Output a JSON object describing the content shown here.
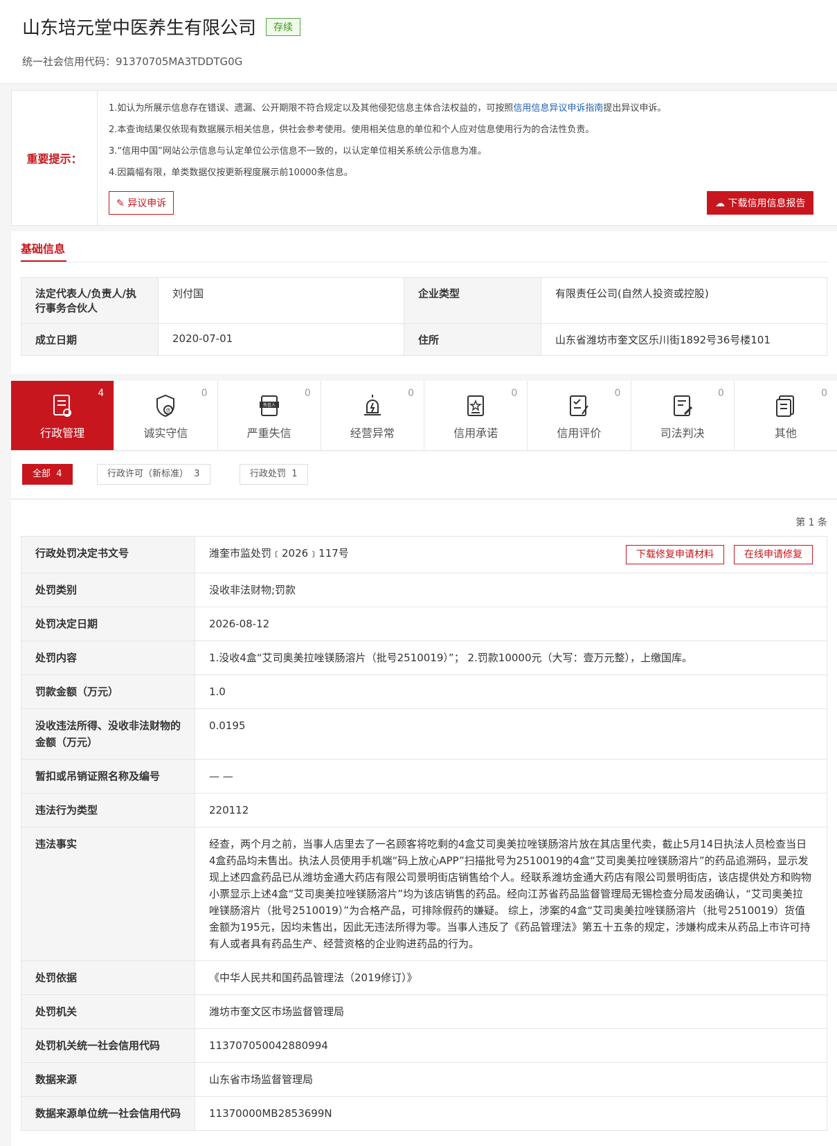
{
  "company": {
    "name": "山东培元堂中医养生有限公司",
    "status": "存续",
    "credit_code_label": "统一社会信用代码：",
    "credit_code": "91370705MA3TDDTG0G"
  },
  "notice": {
    "label": "重要提示：",
    "line1_prefix": "1.如认为所展示信息存在错误、遗漏、公开期限不符合规定以及其他侵犯信息主体合法权益的，可按照",
    "line1_link": "信用信息异议申诉指南",
    "line1_suffix": "提出异议申诉。",
    "line2": "2.本查询结果仅依现有数据展示相关信息，供社会参考使用。使用相关信息的单位和个人应对信息使用行为的合法性负责。",
    "line3": "3.“信用中国”网站公示信息与认定单位公示信息不一致的，以认定单位相关系统公示信息为准。",
    "line4": "4.因篇幅有限，单类数据仅按更新程度展示前10000条信息。",
    "objection_button": "异议申诉",
    "download_button": "下载信用信息报告"
  },
  "basic": {
    "title": "基础信息",
    "legal_rep_label": "法定代表人/负责人/执行事务合伙人",
    "legal_rep_value": "刘付国",
    "type_label": "企业类型",
    "type_value": "有限责任公司(自然人投资或控股)",
    "founded_label": "成立日期",
    "founded_value": "2020-07-01",
    "address_label": "住所",
    "address_value": "山东省潍坊市奎文区乐川街1892号36号楼101"
  },
  "tabs": [
    {
      "label": "行政管理",
      "count": "4",
      "icon": "admin-doc-icon"
    },
    {
      "label": "诚实守信",
      "count": "0",
      "icon": "shield-icon"
    },
    {
      "label": "严重失信",
      "count": "0",
      "icon": "dishonest-icon"
    },
    {
      "label": "经营异常",
      "count": "0",
      "icon": "alarm-icon"
    },
    {
      "label": "信用承诺",
      "count": "0",
      "icon": "promise-icon"
    },
    {
      "label": "信用评价",
      "count": "0",
      "icon": "rating-icon"
    },
    {
      "label": "司法判决",
      "count": "0",
      "icon": "judgement-icon"
    },
    {
      "label": "其他",
      "count": "0",
      "icon": "other-icon"
    }
  ],
  "filters": [
    {
      "label": "全部",
      "count": "4"
    },
    {
      "label": "行政许可（新标准）",
      "count": "3"
    },
    {
      "label": "行政处罚",
      "count": "1"
    }
  ],
  "detail": {
    "page_count": "第 1 条",
    "download_repair_button": "下载修复申请材料",
    "online_repair_button": "在线申请修复",
    "rows": [
      {
        "label": "行政处罚决定书文号",
        "value": "潍奎市监处罚﹝2026﹞117号"
      },
      {
        "label": "处罚类别",
        "value": "没收非法财物;罚款"
      },
      {
        "label": "处罚决定日期",
        "value": "2026-08-12"
      },
      {
        "label": "处罚内容",
        "value": "1.没收4盒“艾司奥美拉唑镁肠溶片（批号2510019）”； 2.罚款10000元（大写：壹万元整），上缴国库。"
      },
      {
        "label": "罚款金额（万元）",
        "value": "1.0"
      },
      {
        "label": "没收违法所得、没收非法财物的金额（万元）",
        "value": "0.0195"
      },
      {
        "label": "暂扣或吊销证照名称及编号",
        "value": "— —"
      },
      {
        "label": "违法行为类型",
        "value": "220112"
      },
      {
        "label": "违法事实",
        "value": "经查，两个月之前，当事人店里去了一名顾客将吃剩的4盒艾司奥美拉唑镁肠溶片放在其店里代卖，截止5月14日执法人员检查当日4盒药品均未售出。执法人员使用手机端“码上放心APP”扫描批号为2510019的4盒“艾司奥美拉唑镁肠溶片”的药品追溯码，显示发现上述四盒药品已从潍坊金通大药店有限公司景明街店销售给个人。经联系潍坊金通大药店有限公司景明街店，该店提供处方和购物小票显示上述4盒“艾司奥美拉唑镁肠溶片”均为该店销售的药品。经向江苏省药品监督管理局无锡检查分局发函确认，“艾司奥美拉唑镁肠溶片（批号2510019）”为合格产品，可排除假药的嫌疑。 综上，涉案的4盒“艾司奥美拉唑镁肠溶片（批号2510019）货值金额为195元，因均未售出，因此无违法所得为零。当事人违反了《药品管理法》第五十五条的规定，涉嫌构成未从药品上市许可持有人或者具有药品生产、经营资格的企业购进药品的行为。"
      },
      {
        "label": "处罚依据",
        "value": "《中华人民共和国药品管理法（2019修订）》"
      },
      {
        "label": "处罚机关",
        "value": "潍坊市奎文区市场监督管理局"
      },
      {
        "label": "处罚机关统一社会信用代码",
        "value": "113707050042880994"
      },
      {
        "label": "数据来源",
        "value": "山东省市场监督管理局"
      },
      {
        "label": "数据来源单位统一社会信用代码",
        "value": "11370000MB2853699N"
      }
    ]
  },
  "colors": {
    "brand_red": "#c8161e",
    "status_green": "#389e0d",
    "link_blue": "#1d5fb6"
  }
}
